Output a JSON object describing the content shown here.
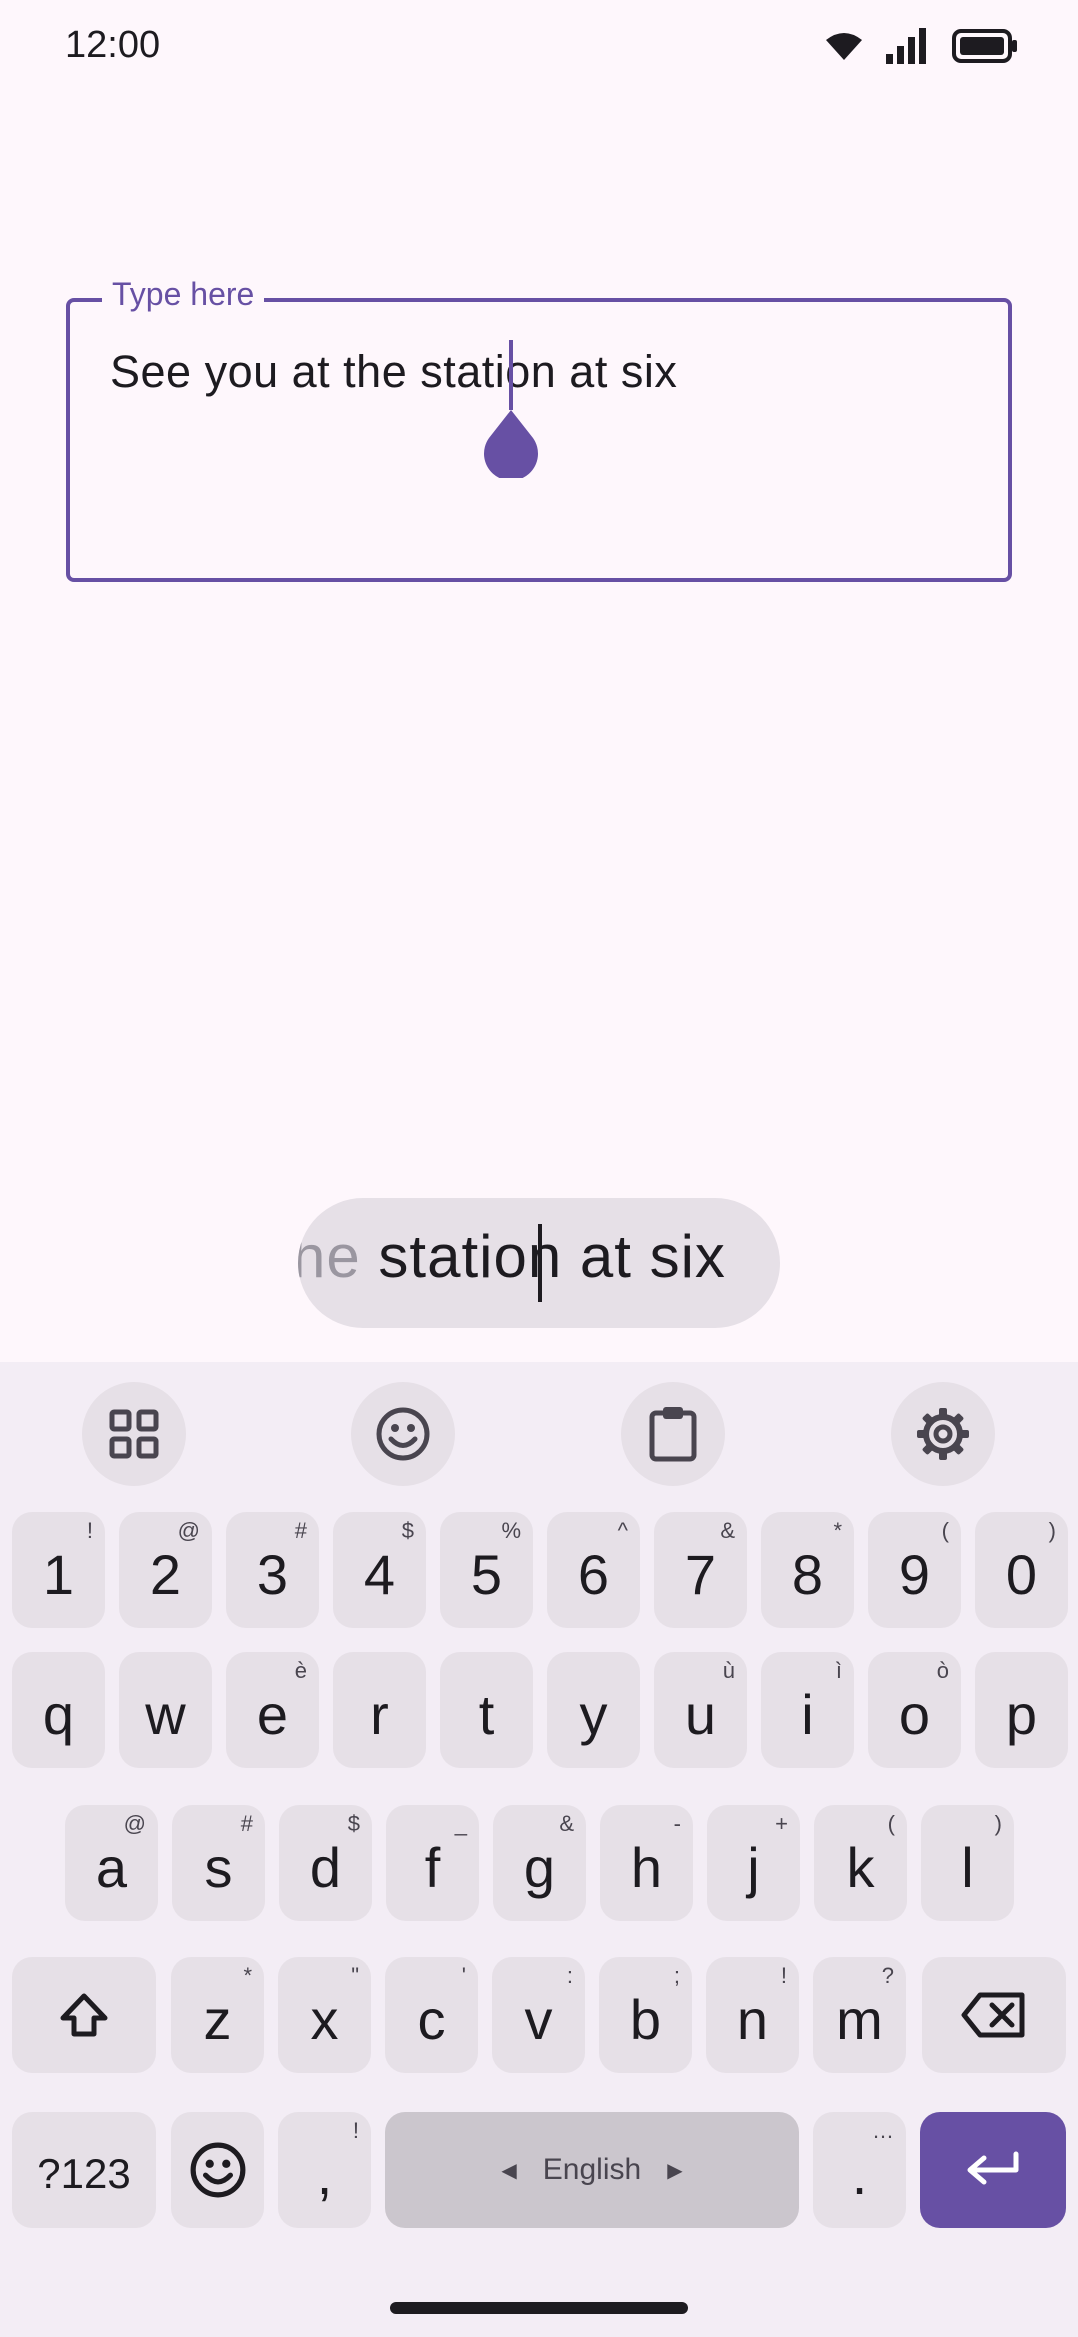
{
  "status": {
    "time": "12:00",
    "icons": [
      "wifi-icon",
      "signal-icon",
      "battery-icon"
    ]
  },
  "field": {
    "label": "Type here",
    "value": "See you at the station at six"
  },
  "magnifier": {
    "faded": "he",
    "before": " statio",
    "after": "n at six"
  },
  "toolbar": {
    "items": [
      "apps-grid-icon",
      "emoji-icon",
      "clipboard-icon",
      "settings-gear-icon"
    ]
  },
  "keyboard": {
    "number_row": [
      {
        "k": "1",
        "h": "!"
      },
      {
        "k": "2",
        "h": "@"
      },
      {
        "k": "3",
        "h": "#"
      },
      {
        "k": "4",
        "h": "$"
      },
      {
        "k": "5",
        "h": "%"
      },
      {
        "k": "6",
        "h": "^"
      },
      {
        "k": "7",
        "h": "&"
      },
      {
        "k": "8",
        "h": "*"
      },
      {
        "k": "9",
        "h": "("
      },
      {
        "k": "0",
        "h": ")"
      }
    ],
    "row1": [
      {
        "k": "q",
        "h": ""
      },
      {
        "k": "w",
        "h": ""
      },
      {
        "k": "e",
        "h": "è"
      },
      {
        "k": "r",
        "h": ""
      },
      {
        "k": "t",
        "h": ""
      },
      {
        "k": "y",
        "h": ""
      },
      {
        "k": "u",
        "h": "ù"
      },
      {
        "k": "i",
        "h": "ì"
      },
      {
        "k": "o",
        "h": "ò"
      },
      {
        "k": "p",
        "h": ""
      }
    ],
    "row2": [
      {
        "k": "a",
        "h": "@"
      },
      {
        "k": "s",
        "h": "#"
      },
      {
        "k": "d",
        "h": "$"
      },
      {
        "k": "f",
        "h": "_"
      },
      {
        "k": "g",
        "h": "&"
      },
      {
        "k": "h",
        "h": "-"
      },
      {
        "k": "j",
        "h": "+"
      },
      {
        "k": "k",
        "h": "("
      },
      {
        "k": "l",
        "h": ")"
      }
    ],
    "row3": [
      {
        "k": "z",
        "h": "*"
      },
      {
        "k": "x",
        "h": "\""
      },
      {
        "k": "c",
        "h": "'"
      },
      {
        "k": "v",
        "h": ":"
      },
      {
        "k": "b",
        "h": ";"
      },
      {
        "k": "n",
        "h": "!"
      },
      {
        "k": "m",
        "h": "?"
      }
    ],
    "symbols_label": "?123",
    "comma": {
      "k": ",",
      "h": "!"
    },
    "space_label": "English",
    "period": {
      "k": ".",
      "h": "…"
    }
  },
  "colors": {
    "accent": "#6750a4",
    "background": "#fef7fc",
    "key": "#e6e0e7",
    "keyboard_bg": "#f3edf5"
  }
}
